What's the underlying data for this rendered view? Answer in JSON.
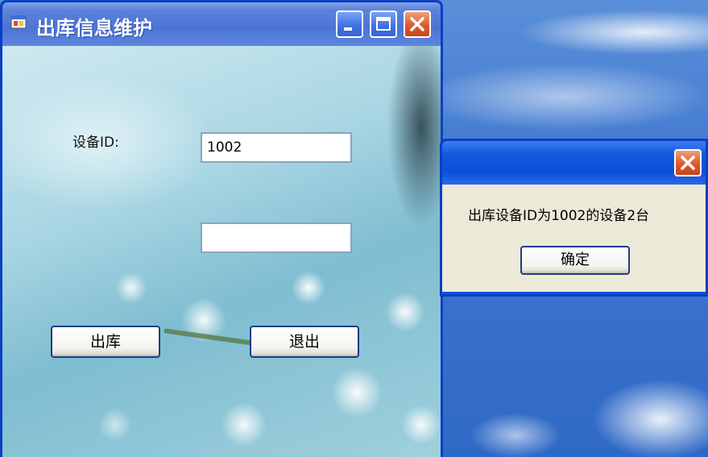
{
  "window": {
    "title": "出库信息维护",
    "controls": [
      "minimize-icon",
      "maximize-icon",
      "close-icon"
    ]
  },
  "form": {
    "device_id_label": "设备ID:",
    "device_id_value": "1002",
    "quantity_value": "",
    "out_button": "出库",
    "exit_button": "退出"
  },
  "dialog": {
    "message": "出库设备ID为1002的设备2台",
    "ok_button": "确定"
  },
  "colors": {
    "titlebar": "#4b74d6",
    "dialog_titlebar": "#0b4fd8",
    "close_button": "#dd5a2c",
    "dialog_body": "#ece9d8"
  }
}
